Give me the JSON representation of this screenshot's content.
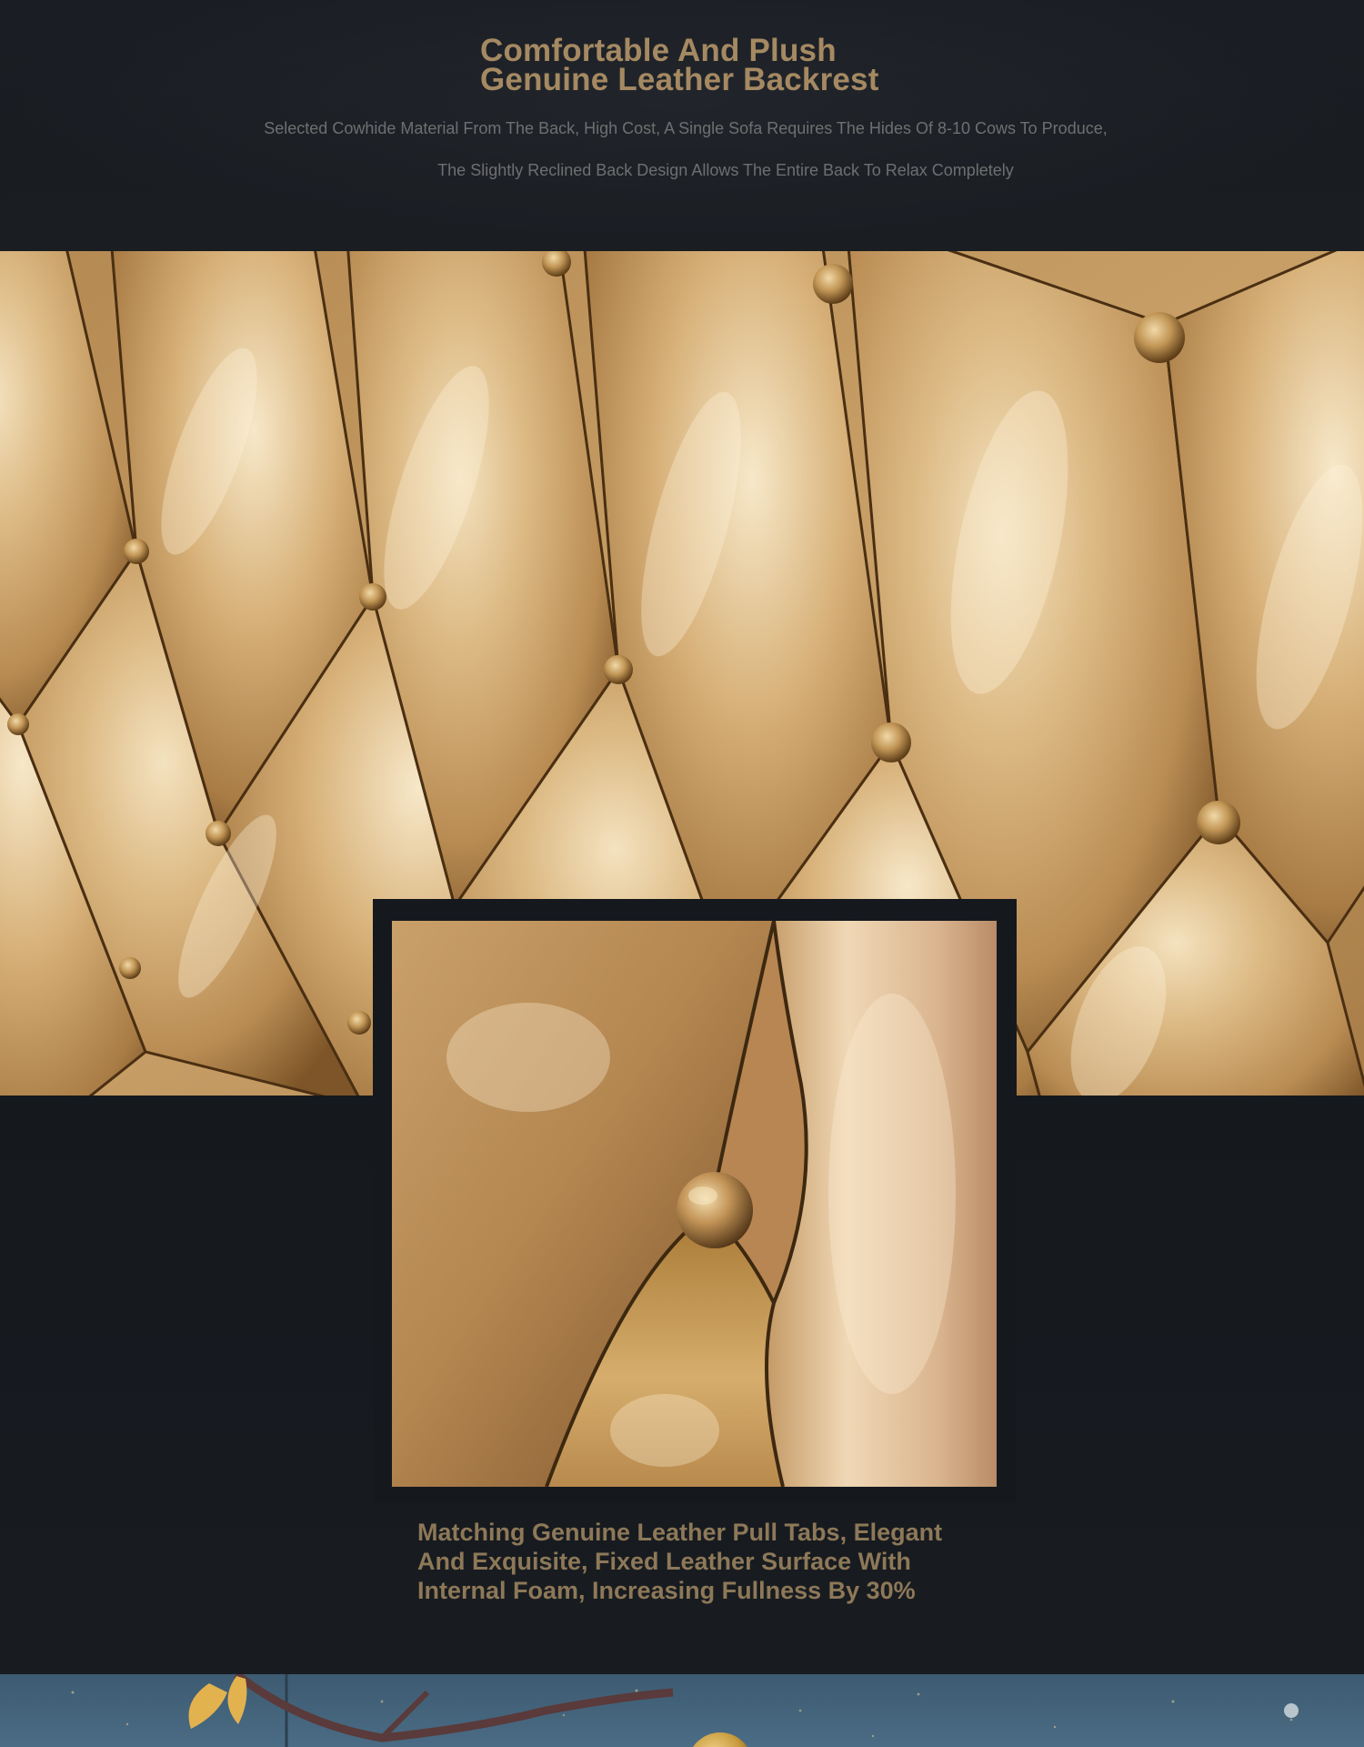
{
  "header": {
    "title_lines": [
      "Comfortable And Plush",
      "Genuine Leather Backrest"
    ],
    "subtitle_lines": [
      "Selected Cowhide Material From The Back, High Cost, A Single Sofa Requires The Hides Of 8-10 Cows To Produce,",
      "The Slightly Reclined Back Design Allows The Entire Back To Relax Completely"
    ]
  },
  "caption": {
    "lines": [
      "Matching Genuine Leather Pull Tabs, Elegant",
      "And Exquisite, Fixed Leather Surface With",
      "Internal Foam, Increasing Fullness By 30%"
    ]
  },
  "colors": {
    "title": "#a58962",
    "subtitle": "#6f6f70",
    "caption": "#8d7858",
    "background": "#14181d",
    "leather_light": "#e8cc9a",
    "leather_mid": "#c59a5f",
    "leather_dark": "#6d4a22",
    "strip": "#4a6c84"
  },
  "images": {
    "main": "tufted-gold-leather-backrest",
    "inset": "leather-button-closeup",
    "strip": "floral-decor-panel"
  }
}
